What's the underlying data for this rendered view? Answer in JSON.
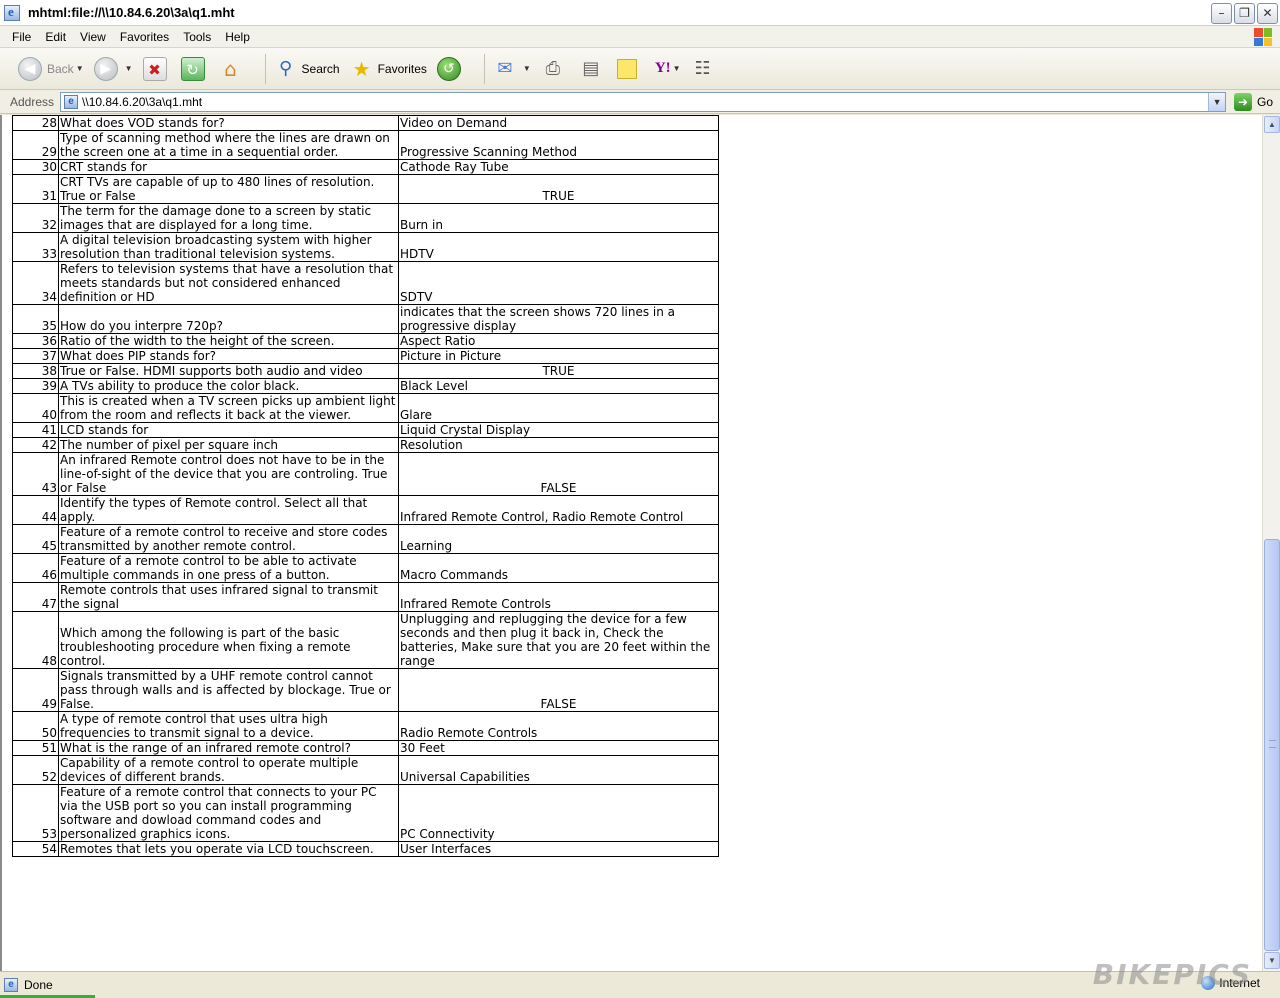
{
  "window": {
    "title": "mhtml:file://\\\\10.84.6.20\\3a\\q1.mht"
  },
  "menu": [
    {
      "label": "File"
    },
    {
      "label": "Edit"
    },
    {
      "label": "View"
    },
    {
      "label": "Favorites"
    },
    {
      "label": "Tools"
    },
    {
      "label": "Help"
    }
  ],
  "toolbar": {
    "back": "Back",
    "search": "Search",
    "favorites": "Favorites"
  },
  "address": {
    "label": "Address",
    "value": "\\\\10.84.6.20\\3a\\q1.mht",
    "go": "Go"
  },
  "status": {
    "text": "Done",
    "zone": "Internet",
    "watermark": "BIKEPICS"
  },
  "rows": [
    {
      "num": "28",
      "q": "What does VOD stands for?",
      "a": "Video on Demand"
    },
    {
      "num": "29",
      "q": "Type of scanning method where the lines are drawn on the screen one at a time in a sequential order.",
      "a": "Progressive Scanning Method"
    },
    {
      "num": "30",
      "q": "CRT stands for",
      "a": "Cathode Ray Tube"
    },
    {
      "num": "31",
      "q": "CRT TVs are capable of up to 480 lines of resolution. True or False",
      "a": "TRUE"
    },
    {
      "num": "32",
      "q": "The term for the damage done to a screen by static images that are displayed for a long time.",
      "a": "Burn in"
    },
    {
      "num": "33",
      "q": "A digital television broadcasting system with higher resolution than traditional television systems.",
      "a": "HDTV"
    },
    {
      "num": "34",
      "q": "Refers to television systems that have a resolution that meets standards but not considered enhanced definition or HD",
      "a": "SDTV"
    },
    {
      "num": "35",
      "q": "How do you interpre 720p?",
      "a": "indicates that the screen shows 720 lines in a progressive display"
    },
    {
      "num": "36",
      "q": "Ratio of the width to the height of the screen.",
      "a": "Aspect Ratio"
    },
    {
      "num": "37",
      "q": "What does PIP stands for?",
      "a": "Picture in Picture"
    },
    {
      "num": "38",
      "q": "True or False. HDMI supports both audio and video",
      "a": "TRUE"
    },
    {
      "num": "39",
      "q": "A TVs ability to produce the color black.",
      "a": "Black Level"
    },
    {
      "num": "40",
      "q": "This is created when a TV screen picks up ambient light from the room and reflects it back at the viewer.",
      "a": "Glare"
    },
    {
      "num": "41",
      "q": "LCD stands for",
      "a": "Liquid Crystal Display"
    },
    {
      "num": "42",
      "q": "The number of pixel per square inch",
      "a": "Resolution"
    },
    {
      "num": "43",
      "q": "An infrared Remote control does not have to be in the line-of-sight of the device that you are controling. True or False",
      "a": "FALSE"
    },
    {
      "num": "44",
      "q": "Identify the types of Remote control. Select all that apply.",
      "a": "Infrared Remote Control, Radio Remote Control"
    },
    {
      "num": "45",
      "q": "Feature of a remote control to receive and store codes transmitted by another remote control.",
      "a": "Learning"
    },
    {
      "num": "46",
      "q": "Feature of a remote control to be able to activate multiple commands in one press of a button.",
      "a": "Macro Commands"
    },
    {
      "num": "47",
      "q": "Remote controls that uses infrared signal to transmit the signal",
      "a": "Infrared Remote Controls"
    },
    {
      "num": "48",
      "q": "Which among the following is part of the basic troubleshooting procedure when fixing a remote control.",
      "a": "Unplugging and replugging the device for a few seconds and then plug it back in, Check the batteries, Make sure that you are 20 feet within the range"
    },
    {
      "num": "49",
      "q": "Signals transmitted by a UHF remote control cannot pass through walls and is affected by blockage. True or False.",
      "a": "FALSE"
    },
    {
      "num": "50",
      "q": "A type of remote control that uses ultra high frequencies to transmit signal to a device.",
      "a": "Radio Remote Controls"
    },
    {
      "num": "51",
      "q": "What is the range of an infrared remote control?",
      "a": "30 Feet"
    },
    {
      "num": "52",
      "q": "Capability of a remote control to operate multiple devices of different brands.",
      "a": "Universal Capabilities"
    },
    {
      "num": "53",
      "q": "Feature of a remote control that connects to your PC via the USB port so you can install programming software and dowload command codes and personalized graphics icons.",
      "a": "PC Connectivity"
    },
    {
      "num": "54",
      "q": "Remotes that lets you operate via LCD touchscreen.",
      "a": "User Interfaces"
    }
  ]
}
